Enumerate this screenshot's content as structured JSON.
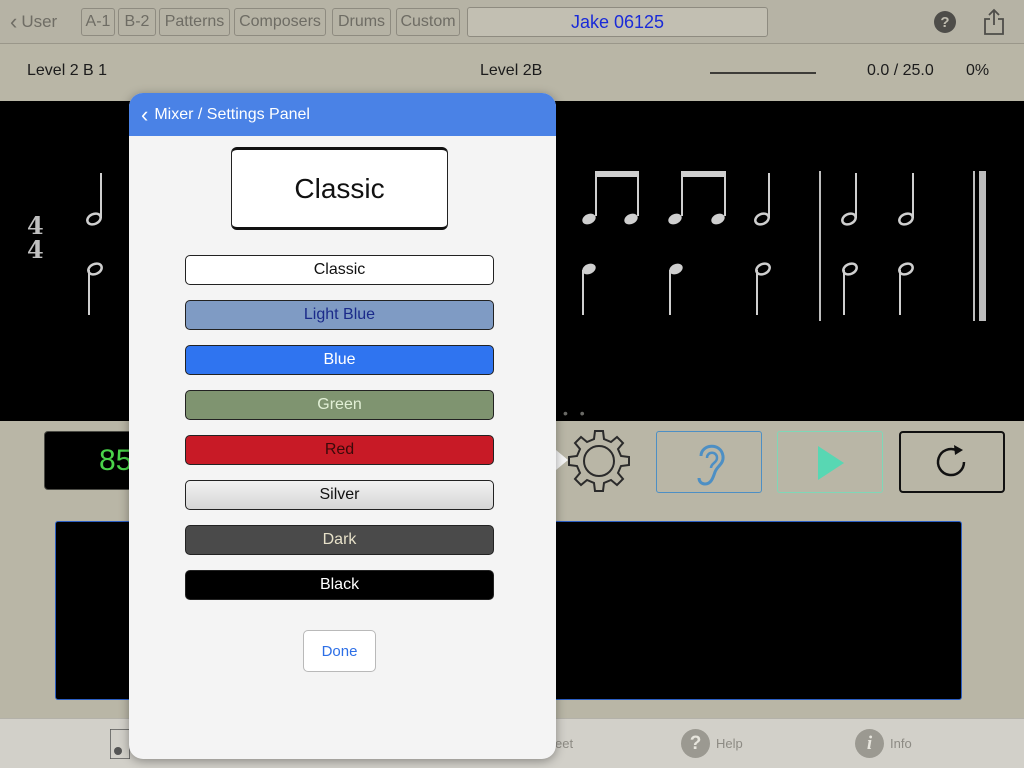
{
  "toolbar": {
    "back_label": "User",
    "tabs": [
      "A-1",
      "B-2",
      "Patterns",
      "Composers",
      "Drums",
      "Custom"
    ],
    "user_name": "Jake 06125",
    "icons": [
      "chevron-left-icon",
      "help-icon",
      "share-icon"
    ]
  },
  "status": {
    "level_left": "Level 2 B 1",
    "level_center": "Level 2B",
    "time": "0.0 / 25.0",
    "percent": "0%"
  },
  "score": {
    "time_signature_top": "4",
    "time_signature_bottom": "4"
  },
  "controls": {
    "tempo": "85",
    "page_dots": "• •"
  },
  "popover": {
    "title": "Mixer / Settings Panel",
    "preview_label": "Classic",
    "themes": [
      {
        "label": "Classic",
        "bg": "#ffffff",
        "fg": "#111111"
      },
      {
        "label": "Light Blue",
        "bg": "#7f9bc4",
        "fg": "#1a2a8a"
      },
      {
        "label": "Blue",
        "bg": "#2f74f0",
        "fg": "#ffffff"
      },
      {
        "label": "Green",
        "bg": "#7f9470",
        "fg": "#e2f0d6"
      },
      {
        "label": "Red",
        "bg": "#c81a26",
        "fg": "#3a0a0a"
      },
      {
        "label": "Silver",
        "bg": "#dcdcdc",
        "fg": "#111111"
      },
      {
        "label": "Dark",
        "bg": "#4a4a4a",
        "fg": "#e6e0c8"
      },
      {
        "label": "Black",
        "bg": "#000000",
        "fg": "#ffffff"
      }
    ],
    "done_label": "Done"
  },
  "tabbar": {
    "sheet_label_fragment": "eet",
    "help_label": "Help",
    "info_label": "Info"
  },
  "colors": {
    "accent": "#4a82e6",
    "tempo_green": "#4ad34a",
    "user_field_text": "#1a2bd8"
  }
}
